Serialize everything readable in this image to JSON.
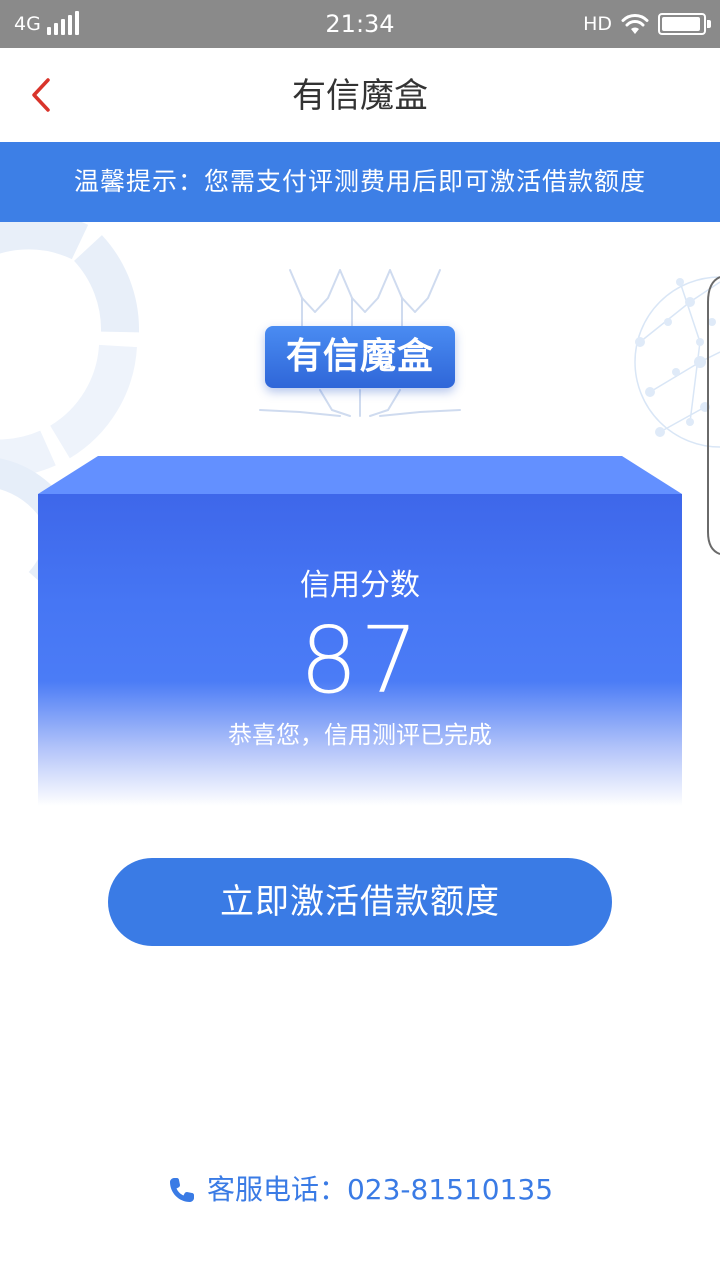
{
  "status_bar": {
    "network": "4G",
    "time": "21:34",
    "hd": "HD",
    "signal_level": 1.0,
    "battery_level": 0.95
  },
  "nav": {
    "title": "有信魔盒",
    "back_icon": "chevron-left-icon"
  },
  "notice": {
    "text": "温馨提示：您需支付评测费用后即可激活借款额度"
  },
  "brand": {
    "logo_text": "有信魔盒"
  },
  "score": {
    "label": "信用分数",
    "value": "87",
    "message": "恭喜您，信用测评已完成"
  },
  "cta": {
    "label": "立即激活借款额度"
  },
  "hotline": {
    "text": "客服电话：023-81510135",
    "icon": "phone-icon"
  },
  "colors": {
    "accent": "#3a7be5",
    "back_icon": "#d9342b",
    "status_bar": "#8a8a8a",
    "card": "#4676f4"
  }
}
